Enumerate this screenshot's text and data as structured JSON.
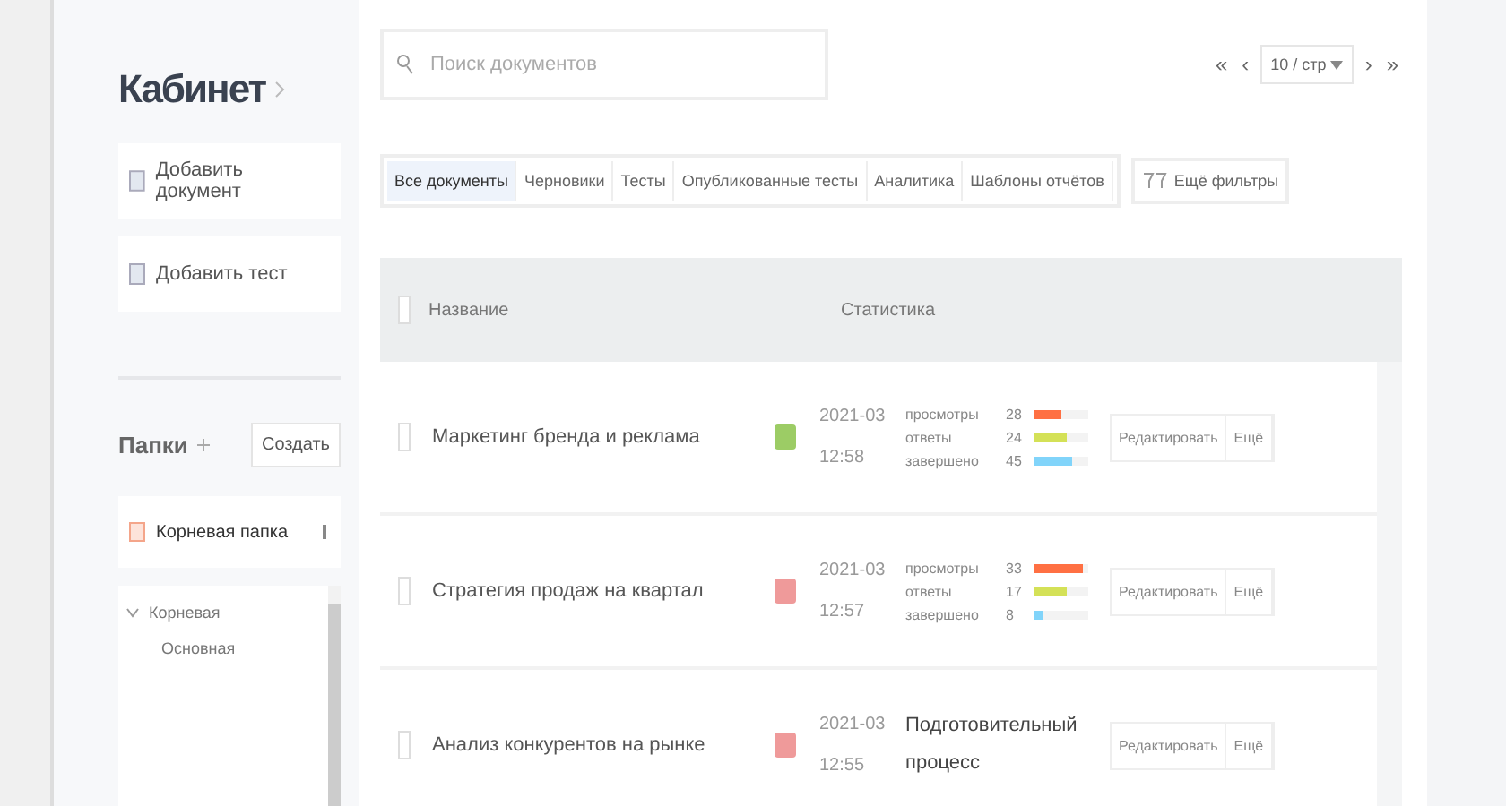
{
  "sidebar": {
    "title": "Кабинет",
    "actions": [
      {
        "label": "Добавить документ"
      },
      {
        "label": "Добавить тест"
      }
    ],
    "folders": {
      "title": "Папки",
      "create_button": "Создать",
      "select": {
        "value": "Корневая папка"
      },
      "tree": [
        {
          "label": "Корневая",
          "expanded": true,
          "children": [
            {
              "label": "Основная"
            }
          ]
        }
      ]
    }
  },
  "search": {
    "placeholder": "Поиск документов"
  },
  "pagination": {
    "first": "«",
    "prev": "‹",
    "page_size": "10 / стр",
    "next": "›",
    "last": "»"
  },
  "filters": [
    {
      "label": "Все документы",
      "selected": true
    },
    {
      "label": "Черновики",
      "selected": false
    },
    {
      "label": "Тесты",
      "selected": false
    },
    {
      "label": "Опубликованные тесты",
      "selected": false
    },
    {
      "label": "Аналитика",
      "selected": false
    },
    {
      "label": "Шаблоны отчётов",
      "selected": false
    }
  ],
  "more_filters": {
    "label": "Ещё фильтры"
  },
  "table": {
    "columns": [
      "Название",
      "Статистика"
    ],
    "select_all": {
      "checked": false
    },
    "rows": [
      {
        "checked": false,
        "title": "Маркетинг бренда и реклама",
        "color": "#9ccc65",
        "date": "2021-03",
        "time": "12:58",
        "kind": "bars",
        "stats": [
          {
            "label": "просмотры",
            "count": "28",
            "color": "#ff7043",
            "level": 0.5
          },
          {
            "label": "ответы",
            "count": "24",
            "color": "#d4e157",
            "level": 0.6
          },
          {
            "label": "завершено",
            "count": "45",
            "color": "#81d4fa",
            "level": 0.7
          }
        ],
        "actions": [
          "Редактировать",
          "Ещё"
        ]
      },
      {
        "checked": false,
        "title": "Стратегия продаж на квартал",
        "color": "#ef9a9a",
        "date": "2021-03",
        "time": "12:57",
        "kind": "bars",
        "stats": [
          {
            "label": "просмотры",
            "count": "33",
            "color": "#ff7043",
            "level": 0.9
          },
          {
            "label": "ответы",
            "count": "17",
            "color": "#d4e157",
            "level": 0.6
          },
          {
            "label": "завершено",
            "count": "8",
            "color": "#81d4fa",
            "level": 0.15
          }
        ],
        "actions": [
          "Редактировать",
          "Ещё"
        ]
      },
      {
        "checked": false,
        "title": "Анализ конкурентов на рынке",
        "color": "#ef9a9a",
        "date": "2021-03",
        "time": "12:55",
        "kind": "text",
        "stats_text": "Подготовительный процесс",
        "actions": [
          "Редактировать",
          "Ещё"
        ]
      }
    ]
  }
}
